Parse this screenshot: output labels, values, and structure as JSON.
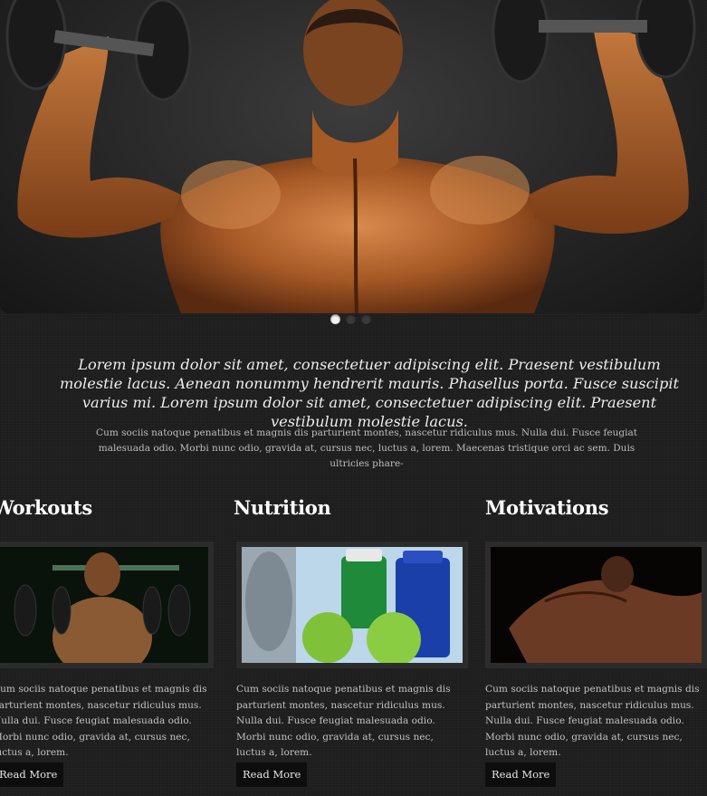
{
  "slider": {
    "active_slide": 1,
    "slide_count": 3
  },
  "intro": {
    "lead": "Lorem ipsum dolor sit amet, consectetuer adipiscing elit. Praesent vestibulum molestie lacus. Aenean nonummy hendrerit mauris. Phasellus porta. Fusce suscipit varius mi. Lorem ipsum dolor sit amet, consectetuer adipiscing elit. Praesent vestibulum molestie lacus.",
    "body": "Cum sociis natoque penatibus et magnis dis parturient montes, nascetur ridiculus mus. Nulla dui. Fusce feugiat malesuada odio. Morbi nunc odio, gravida at, cursus nec, luctus a, lorem. Maecenas tristique orci ac sem. Duis ultricies phare-"
  },
  "columns": [
    {
      "title": "Workouts",
      "text": "Cum sociis natoque penatibus et magnis dis parturient montes, nascetur ridiculus mus. Nulla dui. Fusce feugiat malesuada odio. Morbi nunc odio, gravida at, cursus nec, luctus a, lorem.",
      "button": "Read More"
    },
    {
      "title": "Nutrition",
      "text": "Cum sociis natoque penatibus et magnis dis parturient montes, nascetur ridiculus mus. Nulla dui. Fusce feugiat malesuada odio. Morbi nunc odio, gravida at, cursus nec, luctus a, lorem.",
      "button": "Read More"
    },
    {
      "title": "Motivations",
      "text": "Cum sociis natoque penatibus et magnis dis parturient montes, nascetur ridiculus mus. Nulla dui. Fusce feugiat malesuada odio. Morbi nunc odio, gravida at, cursus nec, luctus a, lorem.",
      "button": "Read More"
    }
  ],
  "colors": {
    "background": "#1f1f1f",
    "heading": "#ffffff",
    "button_bg": "#0d0d0d",
    "skin": "#b5662e"
  }
}
